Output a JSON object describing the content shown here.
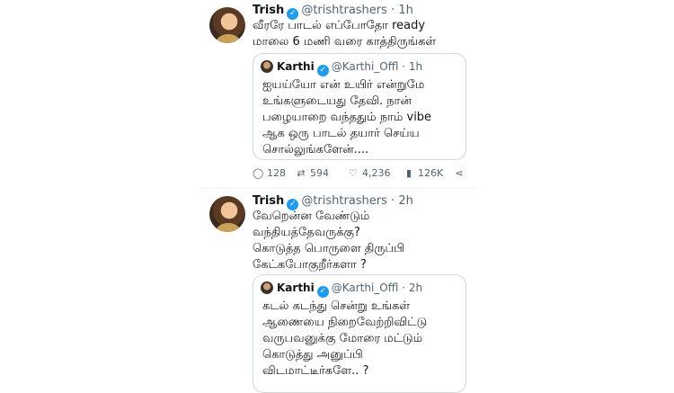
{
  "tweets": [
    {
      "name": "Trish",
      "handle": "@trishtrashers",
      "time": "1h",
      "text_lines": [
        "வீரரே பாடல் எப்போதோ ready",
        "மாலை 6 மணி வரை காத்திருங்கள்"
      ],
      "quote": {
        "name": "Karthi",
        "handle": "@Karthi_Offl",
        "time": "1h",
        "text_lines": [
          "ஐயய்யோ என் உயிர் என்றுமே",
          "உங்களுடையது தேவி.  நான்",
          "பழையாறை வந்ததும் நாம் vibe",
          "ஆக ஒரு பாடல் தயார் செய்ய",
          "சொல்லுங்களேன்...."
        ]
      },
      "stats": {
        "replies": "128",
        "retweets": "594",
        "likes": "4,236",
        "views": "126K"
      }
    },
    {
      "name": "Trish",
      "handle": "@trishtrashers",
      "time": "2h",
      "text_lines": [
        "வேறென்ன வேண்டும்",
        "வந்தியத்தேவருக்கு?",
        "கொடுத்த பொருளை திருப்பி",
        "கேட்கபோகுறீர்களா ?"
      ],
      "quote": {
        "name": "Karthi",
        "handle": "@Karthi_Offl",
        "time": "2h",
        "text_lines": [
          "கடல் கடந்து சென்று உங்கள்",
          "ஆணையை நிறைவேற்றிவிட்டு",
          "வருபவனுக்கு மோரை மட்டும்",
          "கொடுத்து அனுப்பி",
          "விடமாட்டீர்களே.. ?"
        ]
      }
    }
  ],
  "icons": {
    "verified": "verified-badge-icon",
    "reply": "reply-icon",
    "retweet": "retweet-icon",
    "like": "heart-icon",
    "views": "views-icon",
    "share": "share-icon"
  },
  "colors": {
    "verified": "#1d9bf0",
    "muted": "#536471",
    "border": "#cfd9de"
  }
}
